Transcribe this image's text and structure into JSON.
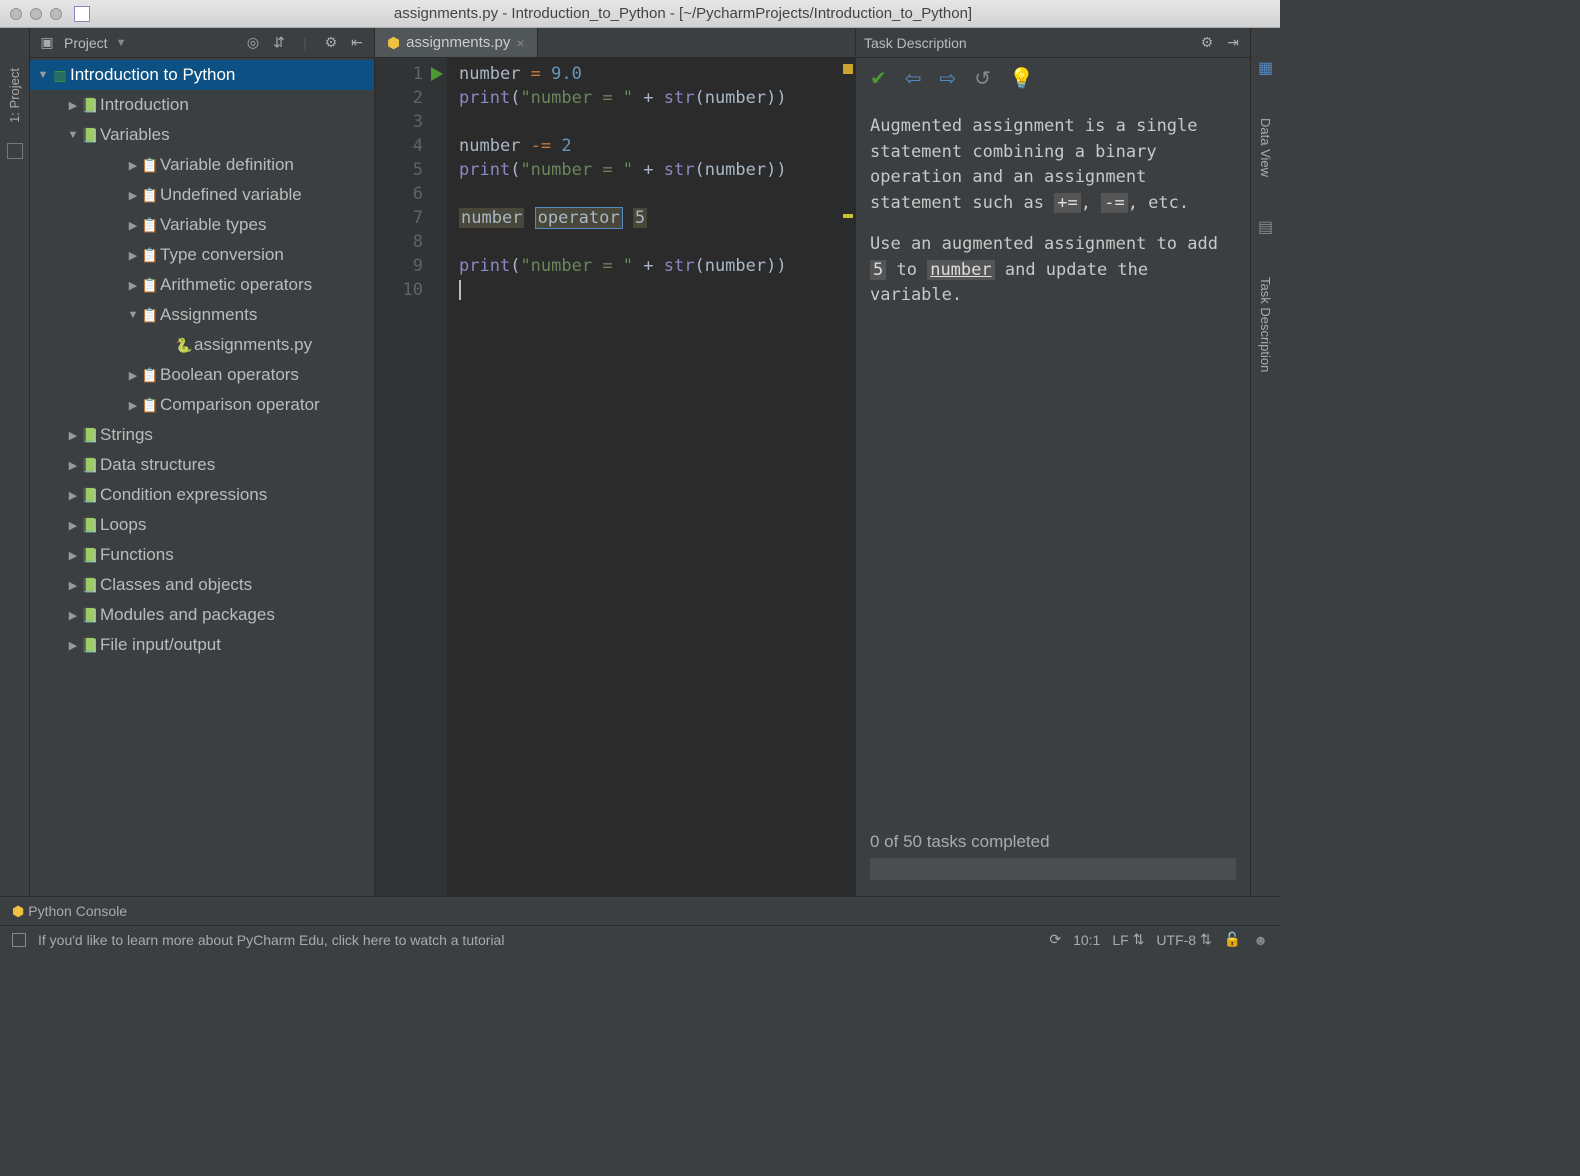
{
  "window": {
    "title": "assignments.py - Introduction_to_Python - [~/PycharmProjects/Introduction_to_Python]"
  },
  "left_rail": {
    "project_label": "1: Project"
  },
  "right_rail": {
    "data_view": "Data View",
    "task_description": "Task Description"
  },
  "project_panel": {
    "header_label": "Project",
    "tree": {
      "root": "Introduction to Python",
      "items": [
        {
          "label": "Introduction",
          "depth": 1,
          "arrow": "▶",
          "icon": "lesson"
        },
        {
          "label": "Variables",
          "depth": 1,
          "arrow": "▼",
          "icon": "lesson"
        },
        {
          "label": "Variable definition",
          "depth": 2,
          "arrow": "▶",
          "icon": "task"
        },
        {
          "label": "Undefined variable",
          "depth": 2,
          "arrow": "▶",
          "icon": "task"
        },
        {
          "label": "Variable types",
          "depth": 2,
          "arrow": "▶",
          "icon": "task"
        },
        {
          "label": "Type conversion",
          "depth": 2,
          "arrow": "▶",
          "icon": "task"
        },
        {
          "label": "Arithmetic operators",
          "depth": 2,
          "arrow": "▶",
          "icon": "task"
        },
        {
          "label": "Assignments",
          "depth": 2,
          "arrow": "▼",
          "icon": "task"
        },
        {
          "label": "assignments.py",
          "depth": 3,
          "arrow": "",
          "icon": "python"
        },
        {
          "label": "Boolean operators",
          "depth": 2,
          "arrow": "▶",
          "icon": "task"
        },
        {
          "label": "Comparison operator",
          "depth": 2,
          "arrow": "▶",
          "icon": "task"
        },
        {
          "label": "Strings",
          "depth": 1,
          "arrow": "▶",
          "icon": "lesson"
        },
        {
          "label": "Data structures",
          "depth": 1,
          "arrow": "▶",
          "icon": "lesson"
        },
        {
          "label": "Condition expressions",
          "depth": 1,
          "arrow": "▶",
          "icon": "lesson"
        },
        {
          "label": "Loops",
          "depth": 1,
          "arrow": "▶",
          "icon": "lesson"
        },
        {
          "label": "Functions",
          "depth": 1,
          "arrow": "▶",
          "icon": "lesson"
        },
        {
          "label": "Classes and objects",
          "depth": 1,
          "arrow": "▶",
          "icon": "lesson"
        },
        {
          "label": "Modules and packages",
          "depth": 1,
          "arrow": "▶",
          "icon": "lesson"
        },
        {
          "label": "File input/output",
          "depth": 1,
          "arrow": "▶",
          "icon": "lesson"
        }
      ]
    }
  },
  "editor": {
    "tab_label": "assignments.py",
    "lines": {
      "l1a": "number ",
      "l1b": "= ",
      "l1c": "9.0",
      "l2a": "print",
      "l2b": "(",
      "l2c": "\"number = \"",
      "l2d": " + ",
      "l2e": "str",
      "l2f": "(number))",
      "l4a": "number ",
      "l4b": "-= ",
      "l4c": "2",
      "l5a": "print",
      "l5b": "(",
      "l5c": "\"number = \"",
      "l5d": " + ",
      "l5e": "str",
      "l5f": "(number))",
      "l7a": "number",
      "l7b": "operator",
      "l7c": "5",
      "l9a": "print",
      "l9b": "(",
      "l9c": "\"number = \"",
      "l9d": " + ",
      "l9e": "str",
      "l9f": "(number))"
    },
    "line_numbers": [
      "1",
      "2",
      "3",
      "4",
      "5",
      "6",
      "7",
      "8",
      "9",
      "10"
    ]
  },
  "task_panel": {
    "header": "Task Description",
    "body": {
      "p1a": "Augmented assignment is a single statement combining a binary operation and an assignment statement such as ",
      "c1": "+=",
      "sep1": ", ",
      "c2": "-=",
      "sep2": ", etc.",
      "p2a": "Use an augmented assignment to add ",
      "c3": "5",
      "p2b": " to ",
      "c4": "number",
      "p2c": " and update the variable."
    },
    "progress": "0 of 50 tasks completed"
  },
  "bottom": {
    "python_console": "Python Console",
    "hint": "If you'd like to learn more about PyCharm Edu, click here to watch a tutorial",
    "pos": "10:1",
    "sep": "LF",
    "enc": "UTF-8"
  }
}
